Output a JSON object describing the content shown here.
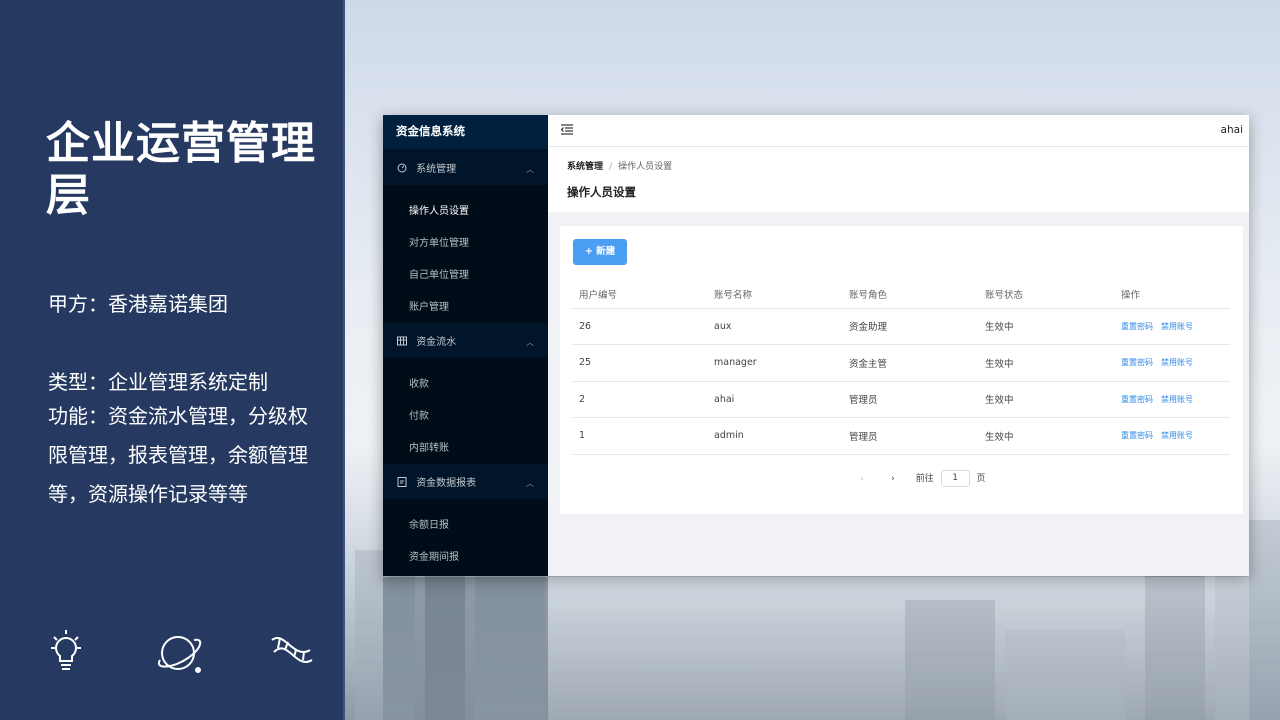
{
  "slide": {
    "title": "企业运营管理层",
    "client": "甲方：香港嘉诺集团",
    "type": "类型：企业管理系统定制",
    "features": "功能：资金流水管理，分级权限管理，报表管理，余额管理等，资源操作记录等等",
    "icons": [
      "lightbulb-icon",
      "planet-icon",
      "dna-icon"
    ]
  },
  "app": {
    "brand": "资金信息系统",
    "user": "ahai",
    "sidebar": {
      "groups": [
        {
          "label": "系统管理",
          "icon": "dashboard-icon",
          "items": [
            "操作人员设置",
            "对方单位管理",
            "自己单位管理",
            "账户管理"
          ]
        },
        {
          "label": "资金流水",
          "icon": "table-icon",
          "items": [
            "收款",
            "付款",
            "内部转账"
          ]
        },
        {
          "label": "资金数据报表",
          "icon": "report-icon",
          "items": [
            "余额日报",
            "资金期间报"
          ]
        }
      ],
      "active": "操作人员设置"
    },
    "breadcrumb": [
      "系统管理",
      "/",
      "操作人员设置"
    ],
    "page_title": "操作人员设置",
    "new_button": "+ 新建",
    "table": {
      "columns": [
        "用户编号",
        "账号名称",
        "账号角色",
        "账号状态",
        "操作"
      ],
      "rows": [
        {
          "id": "26",
          "name": "aux",
          "role": "资金助理",
          "status": "生效中"
        },
        {
          "id": "25",
          "name": "manager",
          "role": "资金主管",
          "status": "生效中"
        },
        {
          "id": "2",
          "name": "ahai",
          "role": "管理员",
          "status": "生效中"
        },
        {
          "id": "1",
          "name": "admin",
          "role": "管理员",
          "status": "生效中"
        }
      ],
      "actions": [
        "重置密码",
        "禁用账号"
      ]
    },
    "pager": {
      "prev": "‹",
      "next": "›",
      "goto_label": "前往",
      "page": "1",
      "page_suffix": "页"
    },
    "colors": {
      "sidebar": "#001529",
      "accent": "#4a9ff5",
      "link": "#2f8ae6",
      "panel": "#263961"
    }
  }
}
